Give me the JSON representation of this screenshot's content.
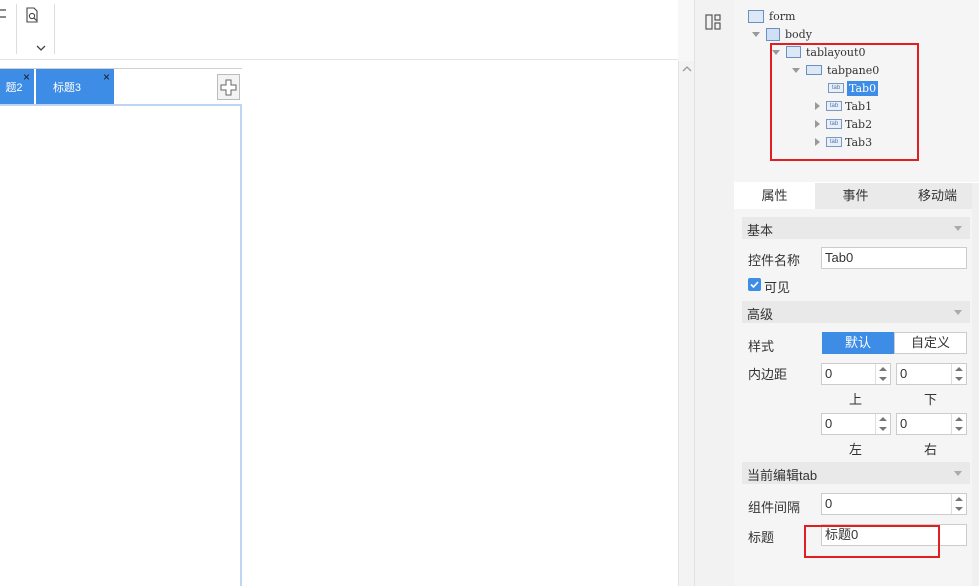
{
  "canvas": {
    "tabs": [
      {
        "label": "题2",
        "close": "×"
      },
      {
        "label": "标题3",
        "close": "×"
      }
    ]
  },
  "tree": {
    "items": [
      {
        "label": "form"
      },
      {
        "label": "body"
      },
      {
        "label": "tablayout0"
      },
      {
        "label": "tabpane0"
      },
      {
        "label": "Tab0"
      },
      {
        "label": "Tab1"
      },
      {
        "label": "Tab2"
      },
      {
        "label": "Tab3"
      }
    ],
    "tab_icon_text": "tab"
  },
  "prop_tabs": [
    "属性",
    "事件",
    "移动端"
  ],
  "basic": {
    "section": "基本",
    "name_label": "控件名称",
    "name_value": "Tab0",
    "visible_label": "可见",
    "visible_checked": true
  },
  "advanced": {
    "section": "高级",
    "style_label": "样式",
    "style_options": [
      "默认",
      "自定义"
    ],
    "style_selected": "默认",
    "padding_label": "内边距",
    "padding": {
      "top": "0",
      "bottom": "0",
      "left": "0",
      "right": "0"
    },
    "padding_captions": {
      "top": "上",
      "bottom": "下",
      "left": "左",
      "right": "右"
    }
  },
  "current_tab": {
    "section": "当前编辑tab",
    "gap_label": "组件间隔",
    "gap_value": "0",
    "title_label": "标题",
    "title_value": "标题0"
  },
  "colors": {
    "accent": "#3d8ce6",
    "highlight": "#e02020"
  }
}
